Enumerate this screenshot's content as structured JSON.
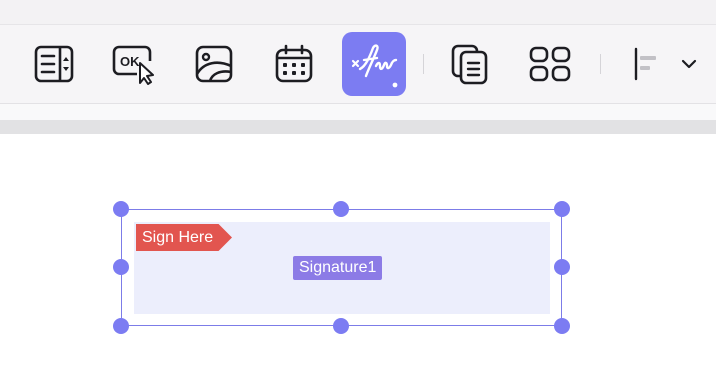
{
  "toolbar": {
    "tools": [
      {
        "name": "list-box-field",
        "icon": "list-box-icon",
        "active": false
      },
      {
        "name": "button-field",
        "icon": "ok-button-icon",
        "label": "OK",
        "active": false
      },
      {
        "name": "image-field",
        "icon": "image-icon",
        "active": false
      },
      {
        "name": "date-field",
        "icon": "calendar-icon",
        "active": false
      },
      {
        "name": "signature-field",
        "icon": "signature-icon",
        "active": true
      },
      {
        "name": "duplicate-field",
        "icon": "duplicate-icon",
        "active": false
      },
      {
        "name": "grid-field",
        "icon": "grid-icon",
        "active": false
      },
      {
        "name": "align",
        "icon": "align-left-icon",
        "active": false
      }
    ],
    "ok_label": "OK",
    "accent": "#7c7cf2"
  },
  "field": {
    "sign_here": "Sign Here",
    "name": "Signature1",
    "border_color": "#7c7ce8",
    "fill_color": "#eceefc",
    "tag_color": "#e2554f",
    "label_color": "#8c7be6"
  }
}
